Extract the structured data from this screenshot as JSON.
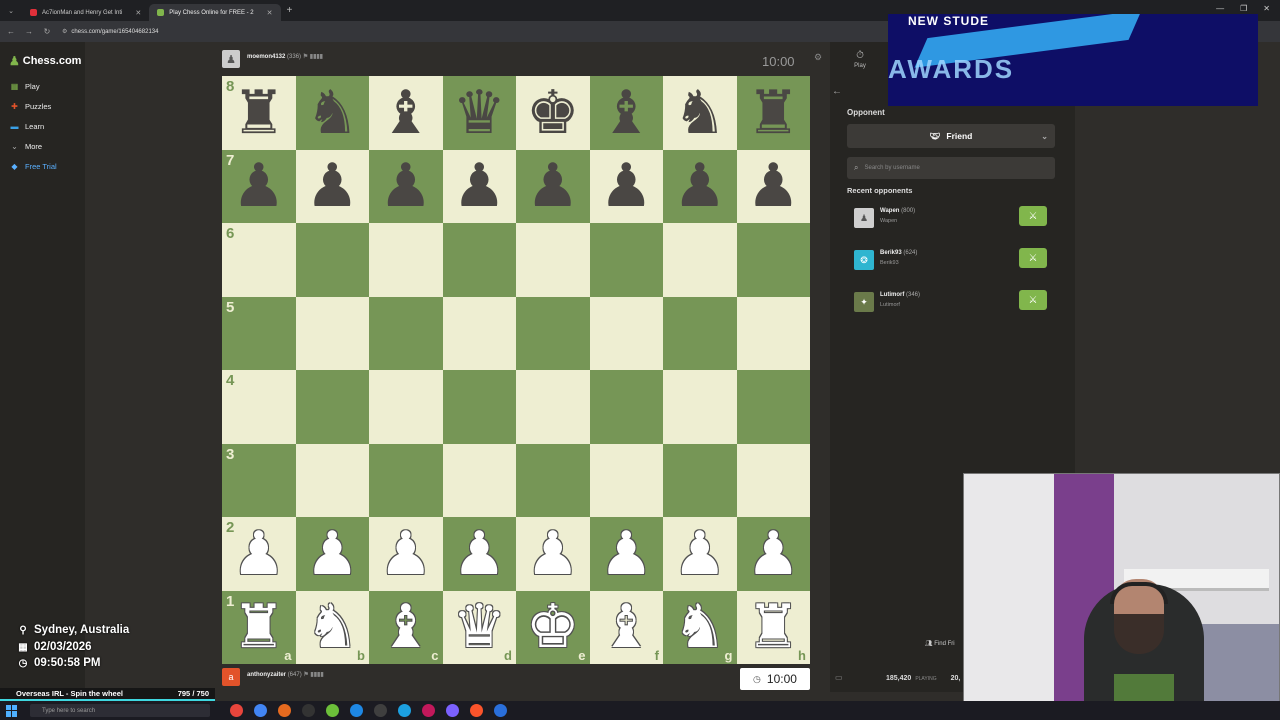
{
  "browser": {
    "tabs": [
      {
        "title": "Ac7ionMan and Henry Get Inti",
        "active": false,
        "favicon_color": "#e0303a"
      },
      {
        "title": "Play Chess Online for FREE - 2",
        "active": true,
        "favicon_color": "#81b64c"
      }
    ],
    "url": "chess.com/game/165404682134"
  },
  "sidebar": {
    "logo": "Chess.com",
    "items": [
      {
        "label": "Play",
        "icon": "play-board-icon",
        "color": "#81b64c"
      },
      {
        "label": "Puzzles",
        "icon": "puzzle-icon",
        "color": "#e2532a"
      },
      {
        "label": "Learn",
        "icon": "learn-icon",
        "color": "#3aa0e6"
      },
      {
        "label": "More",
        "icon": "chevron-down-icon",
        "color": "#aaaaaa"
      },
      {
        "label": "Free Trial",
        "icon": "diamond-icon",
        "color": "#5ab0ff"
      }
    ]
  },
  "game": {
    "top_player": {
      "name": "moemon4132",
      "rating": "(336)",
      "clock": "10:00"
    },
    "bottom_player": {
      "name": "anthonyzaiter",
      "rating": "(647)",
      "avatar_letter": "a",
      "clock": "10:00"
    },
    "ranks": [
      "8",
      "7",
      "6",
      "5",
      "4",
      "3",
      "2",
      "1"
    ],
    "files": [
      "a",
      "b",
      "c",
      "d",
      "e",
      "f",
      "g",
      "h"
    ],
    "position": [
      [
        "bR",
        "bN",
        "bB",
        "bQ",
        "bK",
        "bB",
        "bN",
        "bR"
      ],
      [
        "bP",
        "bP",
        "bP",
        "bP",
        "bP",
        "bP",
        "bP",
        "bP"
      ],
      [
        "",
        "",
        "",
        "",
        "",
        "",
        "",
        ""
      ],
      [
        "",
        "",
        "",
        "",
        "",
        "",
        "",
        ""
      ],
      [
        "",
        "",
        "",
        "",
        "",
        "",
        "",
        ""
      ],
      [
        "",
        "",
        "",
        "",
        "",
        "",
        "",
        ""
      ],
      [
        "wP",
        "wP",
        "wP",
        "wP",
        "wP",
        "wP",
        "wP",
        "wP"
      ],
      [
        "wR",
        "wN",
        "wB",
        "wQ",
        "wK",
        "wB",
        "wN",
        "wR"
      ]
    ],
    "colors": {
      "light": "#eeeed2",
      "dark": "#769656"
    }
  },
  "panel": {
    "play_tab": "Play",
    "opponent_label": "Opponent",
    "friend_select": "Friend",
    "search_placeholder": "Search by username",
    "recent_label": "Recent opponents",
    "recent": [
      {
        "name": "Wapen",
        "rating": "(800)",
        "sub": "Wapen",
        "avatar_color": "#cfcfcf"
      },
      {
        "name": "Berik93",
        "rating": "(624)",
        "sub": "Berik93",
        "avatar_color": "#2fb5d0"
      },
      {
        "name": "Lutimorf",
        "rating": "(346)",
        "sub": "Lutimorf",
        "avatar_color": "#6a7a4a"
      }
    ],
    "find_friends": "Find Fri",
    "playing_count": "185,420",
    "playing_label": "PLAYING",
    "second_count": "20,"
  },
  "overlay": {
    "banner_line1": "NEW STUDE",
    "banner_line2": "AWARDS",
    "location": "Sydney, Australia",
    "date": "02/03/2026",
    "time": "09:50:58 PM",
    "wheel_title": "Overseas IRL - Spin the wheel",
    "wheel_count": "795 / 750",
    "wheel_progress": 1.0
  },
  "taskbar": {
    "search_placeholder": "Type here to search",
    "apps": [
      "#e8453c",
      "#4285f4",
      "#e66a1f",
      "#333333",
      "#6cbf3a",
      "#1e88e5",
      "#3f3f3f",
      "#1ca0e0",
      "#c2185b",
      "#7b61ff",
      "#fb542b",
      "#2a6fdb"
    ]
  }
}
